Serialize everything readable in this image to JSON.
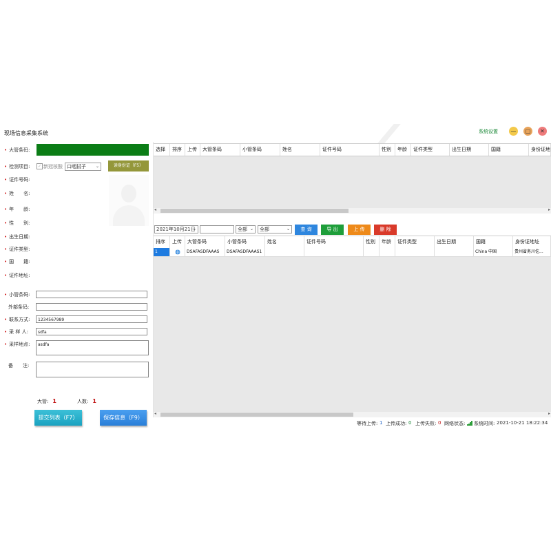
{
  "window": {
    "title": "现场信息采集系统",
    "settings_label": "系统设置",
    "min_glyph": "—",
    "max_glyph": "□",
    "close_glyph": "✕"
  },
  "form": {
    "big_barcode_label": "大管条码:",
    "test_item_label": "检测项目:",
    "test_item_checkbox": "新冠核酸",
    "sample_type": "口咽拭子",
    "read_id_button": "读身份证（F5）",
    "id_number_label": "证件号码:",
    "name_label": "姓　　名:",
    "age_label": "年　　龄:",
    "gender_label": "性　　别:",
    "birthdate_label": "出生日期:",
    "id_type_label": "证件类型:",
    "nationality_label": "国　　籍:",
    "id_address_label": "证件地址:",
    "small_barcode_label": "小管条码:",
    "external_barcode_label": "外部条码:",
    "contact_label": "联系方式:",
    "contact_value": "1234567989",
    "collector_label": "采 样 人:",
    "collector_value": "sdfa",
    "location_label": "采样地点:",
    "location_value": "asdfa",
    "remark_label": "备　　注:",
    "big_tube_count_label": "大管:",
    "big_tube_count": "1",
    "people_count_label": "人数:",
    "people_count": "1",
    "submit_button": "提交列表（F7）",
    "save_button": "保存信息（F9）"
  },
  "top_grid": {
    "columns": [
      "选择",
      "排序",
      "上传",
      "大管条码",
      "小管条码",
      "姓名",
      "证件号码",
      "性别",
      "年龄",
      "证件类型",
      "出生日期",
      "国籍",
      "身份证地址"
    ]
  },
  "toolbar": {
    "date": "2021年10月21日",
    "filter1": "全部",
    "filter2": "全部",
    "query_button": "查 询",
    "export_button": "导 出",
    "upload_button": "上 传",
    "delete_button": "删 除"
  },
  "bottom_grid": {
    "columns": [
      "排序",
      "上传",
      "大管条码",
      "小管条码",
      "姓名",
      "证件号码",
      "性别",
      "年龄",
      "证件类型",
      "出生日期",
      "国籍",
      "身份证地址"
    ],
    "rows": [
      {
        "index": "1",
        "upload_icon": "globe-icon",
        "big_barcode": "DSAFASDFAAAS",
        "small_barcode": "DSAFASDFAAAS1",
        "name": "",
        "id_number": "",
        "gender": "",
        "age": "",
        "id_type": "",
        "birthdate": "",
        "nationality": "China 中国",
        "address": "贵州省务川仡..."
      }
    ]
  },
  "status_bar": {
    "waiting_label": "等待上传:",
    "waiting_value": "1",
    "success_label": "上传成功:",
    "success_value": "0",
    "failed_label": "上传失败:",
    "failed_value": "0",
    "network_label": "网络状态:",
    "system_time_label": "系统时间:",
    "system_time_value": "2021-10-21 18:22:34"
  },
  "colors": {
    "barcode_bar": "#0b7d16",
    "query": "#2e86de",
    "export": "#1e9e3a",
    "upload": "#ee8a1a",
    "delete": "#d93a2a"
  }
}
